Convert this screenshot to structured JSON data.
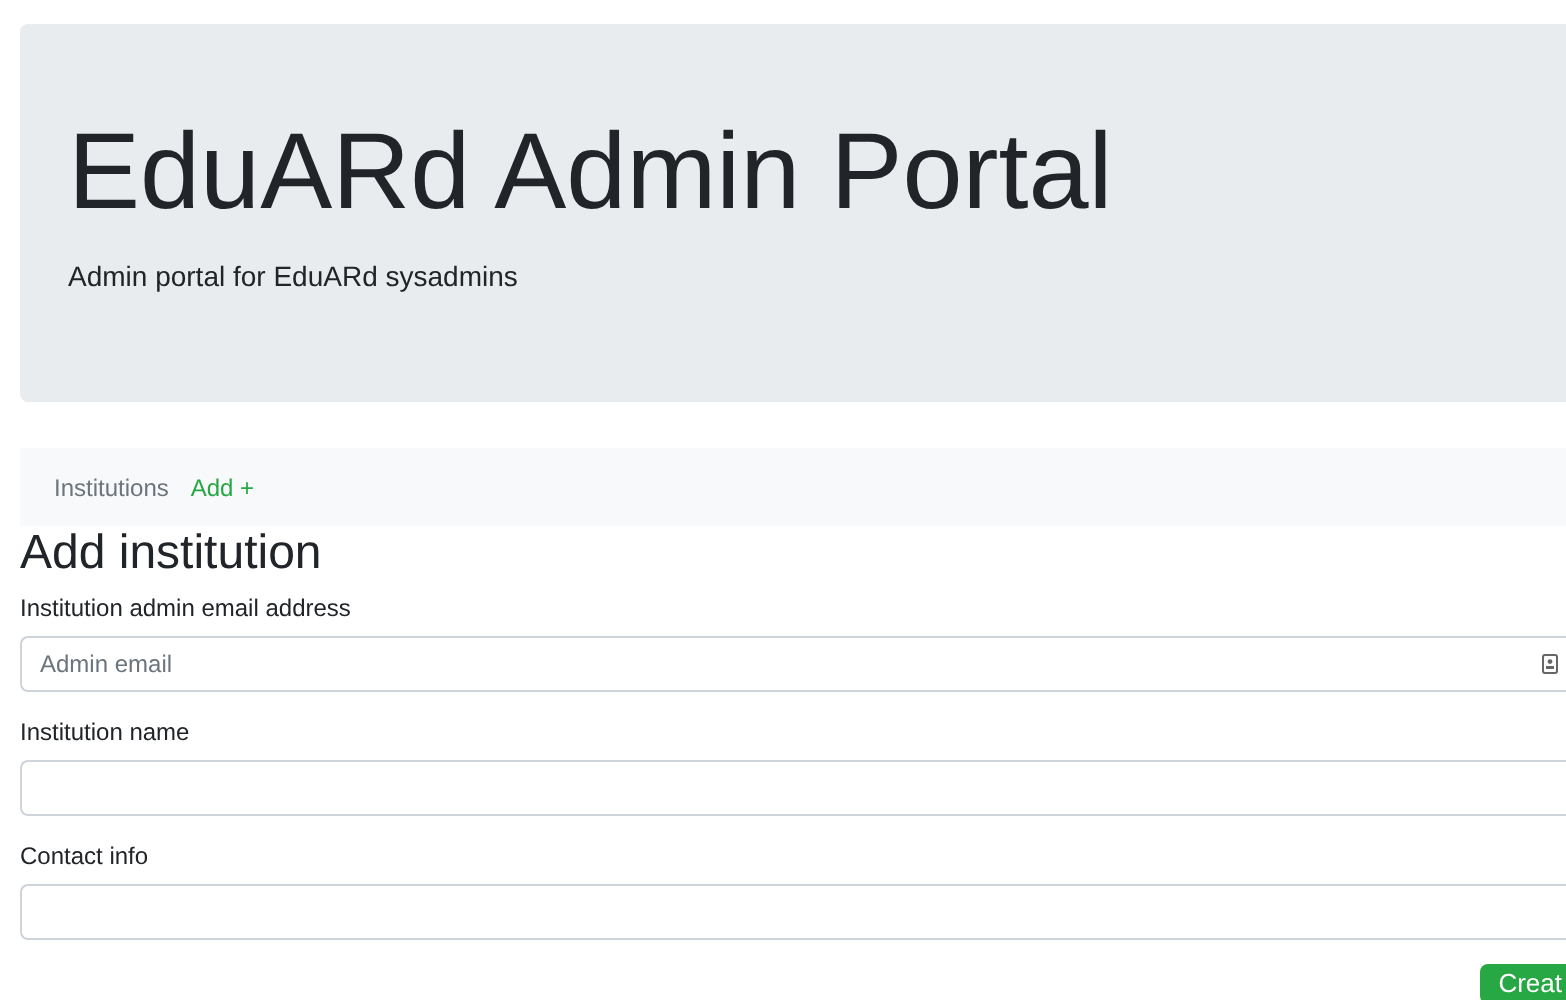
{
  "header": {
    "title": "EduARd Admin Portal",
    "subtitle": "Admin portal for EduARd sysadmins"
  },
  "nav": [
    {
      "label": "Institutions",
      "selected": false
    },
    {
      "label": "Add +",
      "selected": true
    }
  ],
  "form": {
    "title": "Add institution",
    "fields": [
      {
        "label": "Institution admin email address",
        "placeholder": "Admin email",
        "autofill_icon": true
      },
      {
        "label": "Institution name",
        "autofill_icon": false
      },
      {
        "label": "Contact info",
        "autofill_icon": false
      }
    ],
    "submit": "Creat"
  }
}
